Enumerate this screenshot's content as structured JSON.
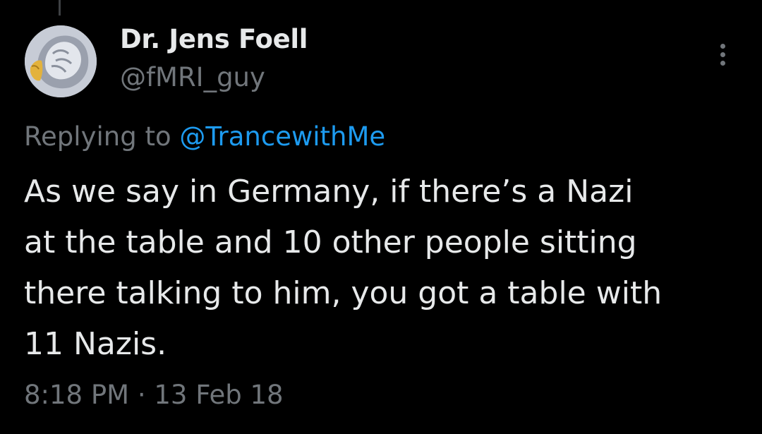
{
  "author": {
    "display_name": "Dr. Jens Foell",
    "handle": "@fMRI_guy",
    "avatar": "brain-scan-avatar"
  },
  "reply": {
    "prefix": "Replying to",
    "mention": "@TrancewithMe"
  },
  "tweet": {
    "lines": [
      "As we say in Germany, if there’s a Nazi",
      "at the table and 10 other people sitting",
      "there talking to him, you got a table with",
      "11 Nazis."
    ]
  },
  "meta": {
    "time": "8:18 PM",
    "separator": "·",
    "date": "13 Feb 18"
  },
  "icons": {
    "more": "more-vertical-icon"
  },
  "colors": {
    "background": "#000000",
    "primary_text": "#e7e9ea",
    "secondary_text": "#71767b",
    "link": "#1d9bf0"
  }
}
